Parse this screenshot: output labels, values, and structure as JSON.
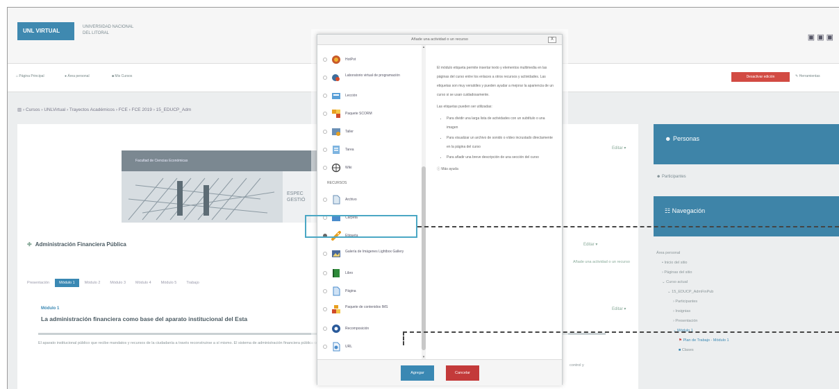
{
  "header": {
    "logo_text": "UNL VIRTUAL",
    "university_line1": "UNIVERSIDAD NACIONAL",
    "university_line2": "DEL LITORAL",
    "social_icons": [
      "facebook-icon",
      "twitter-icon",
      "youtube-icon"
    ]
  },
  "navbar": {
    "items": [
      "Página Principal",
      "Área personal",
      "Mis Cursos"
    ],
    "edit_button": "Desactivar edición",
    "tools": "Herramientas"
  },
  "breadcrumb": {
    "path": [
      "Cursos",
      "UNLVirtual",
      "Trayectos Académicos",
      "FCE",
      "FCE 2019",
      "15_EDUCP_Adm"
    ]
  },
  "main": {
    "banner_header": "Facultad de Ciencias Económicas",
    "banner_side": "ESPEC\nGESTIÓ",
    "edit_label": "Editar",
    "course_title": "Administración Financiera Pública",
    "add_activity_hint": "Añade una actividad o un recurso",
    "tabs": [
      "Presentación",
      "Módulo 1",
      "Módulo 2",
      "Módulo 3",
      "Módulo 4",
      "Módulo 5",
      "Trabajo"
    ],
    "active_tab": 1,
    "module_label": "Módulo 1",
    "module_title": "La administración financiera como base del aparato institucional del Esta",
    "paragraph": "El aparato institucional público que recibe mandatos y recursos de la ciudadanía a través reconstruirse a sí mismo. El sistema de administración financiera pública como herramien cumplimiento de dichos mandatos. Los componentes del sistema de administración finan auditoría",
    "right_note": "control y"
  },
  "sidebar": {
    "personas_title": "Personas",
    "participants_link": "Participantes",
    "navigation_title": "Navegación",
    "nav_tree": [
      {
        "text": "Área personal",
        "level": 0
      },
      {
        "text": "Inicio del sitio",
        "level": 1
      },
      {
        "text": "Páginas del sitio",
        "level": 1
      },
      {
        "text": "Curso actual",
        "level": 1
      },
      {
        "text": "15_EDUCP_AdmFinPub",
        "level": 2
      },
      {
        "text": "Participantes",
        "level": 3
      },
      {
        "text": "Insignias",
        "level": 3
      },
      {
        "text": "Presentación",
        "level": 3
      },
      {
        "text": "Módulo 1",
        "level": 3,
        "highlight": true
      },
      {
        "text": "Plan de Trabajo - Módulo 1",
        "level": 4,
        "highlight": true
      },
      {
        "text": "Clases",
        "level": 4
      }
    ]
  },
  "modal": {
    "title": "Añade una actividad o un recurso",
    "close_label": "X",
    "activities": [
      {
        "label": "HotPot",
        "icon": "hotpot-icon"
      },
      {
        "label": "Laboratorio virtual de programación",
        "icon": "vpl-icon"
      },
      {
        "label": "Lección",
        "icon": "lesson-icon"
      },
      {
        "label": "Paquete SCORM",
        "icon": "scorm-icon"
      },
      {
        "label": "Taller",
        "icon": "workshop-icon"
      },
      {
        "label": "Tarea",
        "icon": "assignment-icon"
      },
      {
        "label": "Wiki",
        "icon": "wiki-icon"
      }
    ],
    "resources_label": "RECURSOS",
    "resources": [
      {
        "label": "Archivo",
        "icon": "file-icon",
        "selected": false
      },
      {
        "label": "Carpeta",
        "icon": "folder-icon",
        "selected": false
      },
      {
        "label": "Etiqueta",
        "icon": "label-icon",
        "selected": true
      },
      {
        "label": "Galería de Imágenes Lightbox Gallery",
        "icon": "gallery-icon",
        "selected": false
      },
      {
        "label": "Libro",
        "icon": "book-icon",
        "selected": false
      },
      {
        "label": "Página",
        "icon": "page-icon",
        "selected": false
      },
      {
        "label": "Paquete de contenidos IMS",
        "icon": "ims-icon",
        "selected": false
      },
      {
        "label": "Recomposición",
        "icon": "recomposicion-icon",
        "selected": false
      },
      {
        "label": "URL",
        "icon": "url-icon",
        "selected": false
      }
    ],
    "description": "El módulo etiqueta permite insertar texto y elementos multimedia en las páginas del curso entre los enlaces a otros recursos y actividades. Las etiquetas son muy versátiles y pueden ayudar a mejorar la apariencia de un curso si se usan cuidadosamente.",
    "uses_intro": "Las etiquetas pueden ser utilizadas:",
    "uses": [
      "Para dividir una larga lista de actividades con un subtítulo o una imagen",
      "Para visualizar un archivo de sonido o vídeo incrustado directamente en la página del curso",
      "Para añadir una breve descripción de una sección del curso"
    ],
    "more_help": "Más ayuda",
    "add_button": "Agregar",
    "cancel_button": "Cancelar"
  },
  "colors": {
    "primary": "#3a88b3",
    "danger": "#c33a3a",
    "panel": "#3e84a8"
  }
}
